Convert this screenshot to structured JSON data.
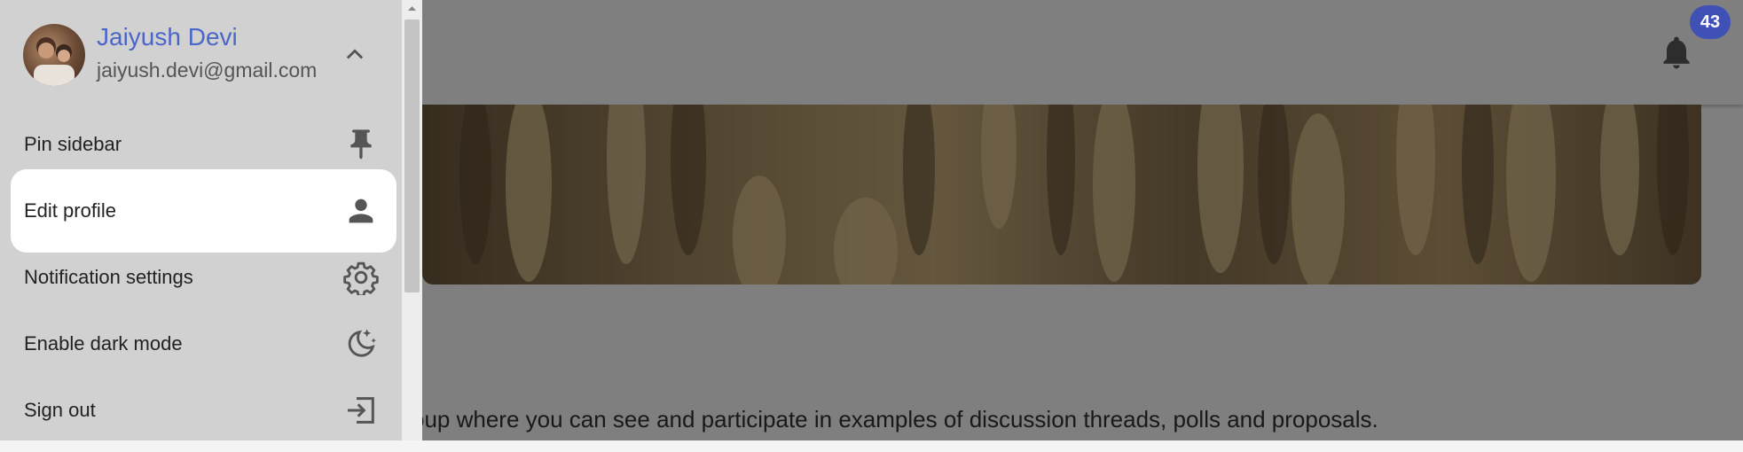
{
  "user": {
    "name": "Jaiyush Devi",
    "email": "jaiyush.devi@gmail.com"
  },
  "menu": {
    "items": [
      {
        "label": "Pin sidebar",
        "icon": "pin-icon"
      },
      {
        "label": "Edit profile",
        "icon": "person-icon"
      },
      {
        "label": "Notification settings",
        "icon": "gear-icon"
      },
      {
        "label": "Enable dark mode",
        "icon": "moon-icon"
      },
      {
        "label": "Sign out",
        "icon": "sign-out-icon"
      }
    ]
  },
  "header": {
    "notification_count": "43"
  },
  "group": {
    "description": "oup where you can see and participate in examples of discussion threads, polls and proposals."
  },
  "colors": {
    "accent": "#3f51b5",
    "name": "#4a67c8",
    "overlay": "rgba(0,0,0,0.5)"
  }
}
